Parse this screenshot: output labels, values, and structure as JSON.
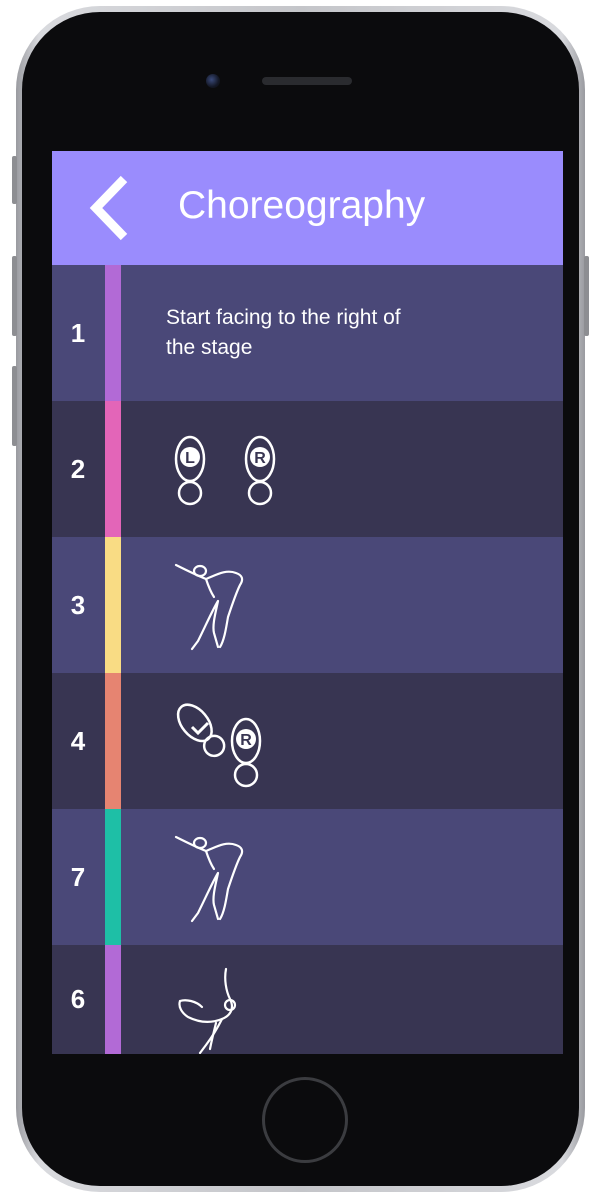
{
  "header": {
    "title": "Choreography",
    "back_icon": "chevron-left-icon"
  },
  "colors": {
    "header_bg": "#9a8cfd",
    "row_light": "#4a4878",
    "row_dark": "#383552",
    "accent_purple": "#b26ad6",
    "accent_pink": "#e365b8",
    "accent_yellow": "#f9dc84",
    "accent_salmon": "#e68471",
    "accent_teal": "#1ebfa6"
  },
  "steps": [
    {
      "number": "1",
      "text": "Start facing to the right of the stage",
      "accent": "#b26ad6"
    },
    {
      "number": "2",
      "icon": "footprints-left-right-icon",
      "left_label": "L",
      "right_label": "R",
      "accent": "#e365b8"
    },
    {
      "number": "3",
      "icon": "dancer-arms-extended-icon",
      "accent": "#f9dc84"
    },
    {
      "number": "4",
      "icon": "footprints-turn-icon",
      "left_label": "L",
      "right_label": "R",
      "accent": "#e68471"
    },
    {
      "number": "7",
      "icon": "dancer-arms-extended-icon",
      "accent": "#1ebfa6"
    },
    {
      "number": "6",
      "icon": "dancer-leg-lift-icon",
      "accent": "#b26ad6"
    }
  ]
}
